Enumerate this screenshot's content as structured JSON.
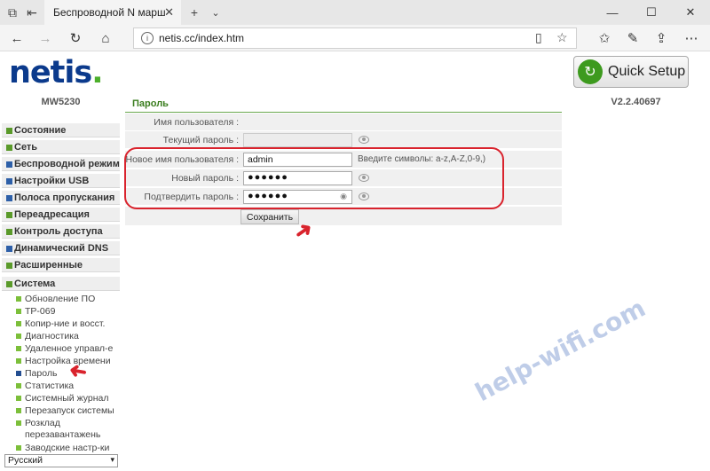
{
  "browser": {
    "tab_title": "Беспроводной N марш",
    "url": "netis.cc/index.htm"
  },
  "header": {
    "logo": "netis",
    "quick_setup": "Quick Setup"
  },
  "sidebar": {
    "model": "MW5230",
    "menu": [
      {
        "label": "Состояние"
      },
      {
        "label": "Сеть"
      },
      {
        "label": "Беспроводной режим"
      },
      {
        "label": "Настройки USB"
      },
      {
        "label": "Полоса пропускания"
      },
      {
        "label": "Переадресация"
      },
      {
        "label": "Контроль доступа"
      },
      {
        "label": "Динамический DNS"
      },
      {
        "label": "Расширенные"
      },
      {
        "label": "Система"
      }
    ],
    "submenu": [
      {
        "label": "Обновление ПО"
      },
      {
        "label": "TP-069"
      },
      {
        "label": "Копир-ние и восст."
      },
      {
        "label": "Диагностика"
      },
      {
        "label": "Удаленное управл-е"
      },
      {
        "label": "Настройка времени"
      },
      {
        "label": "Пароль"
      },
      {
        "label": "Статистика"
      },
      {
        "label": "Системный журнал"
      },
      {
        "label": "Перезапуск системы"
      },
      {
        "label": "Розклад перезавантажень"
      },
      {
        "label": "Заводские настр-ки"
      }
    ],
    "language": "Русский"
  },
  "content": {
    "section_title": "Пароль",
    "username_label": "Имя пользователя :",
    "current_password_label": "Текущий пароль :",
    "new_username_label": "Новое имя пользователя :",
    "new_username_value": "admin",
    "new_username_hint": "Введите символы: a-z,A-Z,0-9,)",
    "new_password_label": "Новый пароль :",
    "new_password_value": "●●●●●●",
    "confirm_password_label": "Подтвердить пароль :",
    "confirm_password_value": "●●●●●●",
    "save_button": "Сохранить"
  },
  "version": "V2.2.40697",
  "watermark": "help-wifi.com",
  "colors": {
    "accent_green": "#3a7d1e",
    "highlight_red": "#d9232d",
    "logo_blue": "#0b3a8c"
  }
}
